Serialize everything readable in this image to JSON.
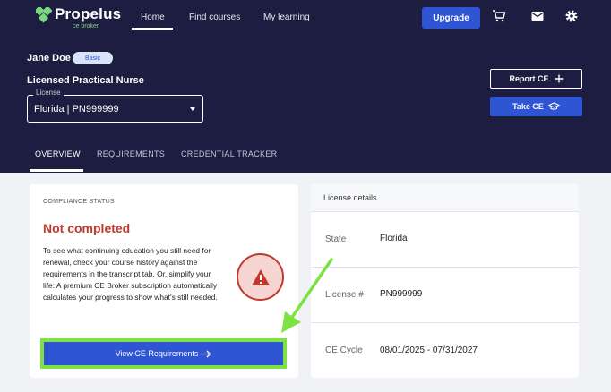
{
  "brand": {
    "name": "Propelus",
    "subtitle": "ce broker",
    "accent": "#7ad77f"
  },
  "nav": {
    "home": "Home",
    "find_courses": "Find courses",
    "my_learning": "My learning",
    "upgrade": "Upgrade",
    "icons": [
      "cart-icon",
      "mail-icon",
      "gear-icon"
    ]
  },
  "user": {
    "name": "Jane Doe",
    "plan": "Basic",
    "profession": "Licensed Practical Nurse"
  },
  "license_select": {
    "label": "License",
    "value": "Florida | PN999999"
  },
  "actions": {
    "report_ce": "Report CE",
    "take_ce": "Take CE"
  },
  "tabs": [
    "OVERVIEW",
    "REQUIREMENTS",
    "CREDENTIAL TRACKER"
  ],
  "compliance": {
    "label": "COMPLIANCE STATUS",
    "status": "Not completed",
    "status_color": "#c0392b",
    "description": "To see what continuing education you still need for renewal, check your course history against the requirements in the transcript tab. Or, simplify your life: A premium CE Broker subscription automatically calculates your progress to show what's still needed.",
    "button": "View CE Requirements"
  },
  "license_details": {
    "title": "License details",
    "rows": [
      {
        "label": "State",
        "value": "Florida"
      },
      {
        "label": "License #",
        "value": "PN999999"
      },
      {
        "label": "CE Cycle",
        "value": "08/01/2025 - 07/31/2027"
      }
    ]
  },
  "colors": {
    "header_bg": "#1c1d40",
    "primary": "#2f55d4",
    "highlight": "#7ee244"
  }
}
